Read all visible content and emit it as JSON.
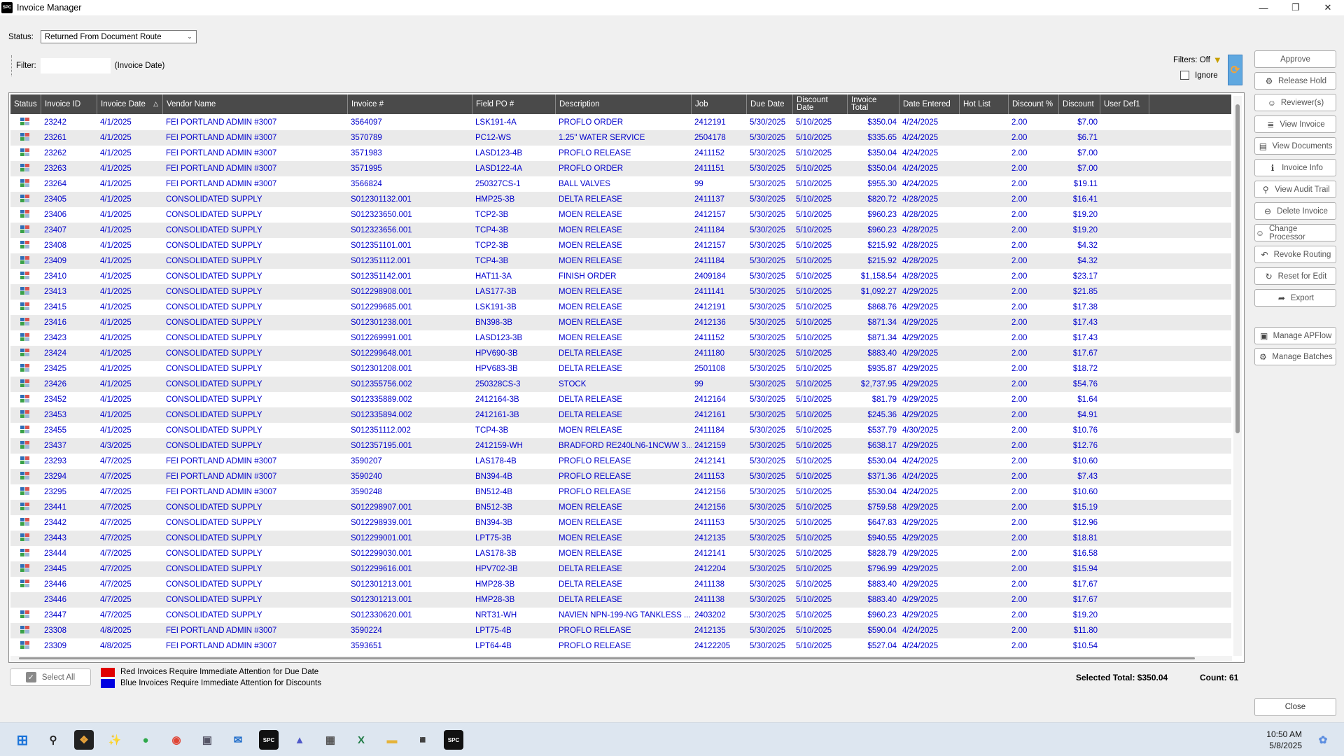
{
  "window": {
    "title": "Invoice Manager",
    "app_icon": "SPC",
    "controls": [
      "minimize-icon",
      "restore-icon",
      "close-icon"
    ]
  },
  "status_filter": {
    "label": "Status:",
    "value": "Returned From Document Route"
  },
  "filter": {
    "label": "Filter:",
    "value": "",
    "hint": "(Invoice Date)"
  },
  "filters_state": {
    "label": "Filters: Off",
    "ignore_label": "Ignore"
  },
  "columns": [
    "Status",
    "Invoice ID",
    "Invoice Date",
    "Vendor Name",
    "Invoice #",
    "Field PO #",
    "Description",
    "Job",
    "Due Date",
    "Discount Date",
    "Invoice Total",
    "Date Entered",
    "Hot List",
    "Discount %",
    "Discount",
    "User Def1"
  ],
  "rows": [
    {
      "id": "23242",
      "date": "4/1/2025",
      "vendor": "FEI PORTLAND ADMIN #3007",
      "inv": "3564097",
      "po": "LSK191-4A",
      "desc": "PROFLO ORDER",
      "job": "2412191",
      "due": "5/30/2025",
      "disc_date": "5/10/2025",
      "total": "$350.04",
      "entered": "4/24/2025",
      "pct": "2.00",
      "disc": "$7.00",
      "icon": true
    },
    {
      "id": "23261",
      "date": "4/1/2025",
      "vendor": "FEI PORTLAND ADMIN #3007",
      "inv": "3570789",
      "po": "PC12-WS",
      "desc": "1.25\" WATER SERVICE",
      "job": "2504178",
      "due": "5/30/2025",
      "disc_date": "5/10/2025",
      "total": "$335.65",
      "entered": "4/24/2025",
      "pct": "2.00",
      "disc": "$6.71",
      "icon": true
    },
    {
      "id": "23262",
      "date": "4/1/2025",
      "vendor": "FEI PORTLAND ADMIN #3007",
      "inv": "3571983",
      "po": "LASD123-4B",
      "desc": "PROFLO RELEASE",
      "job": "2411152",
      "due": "5/30/2025",
      "disc_date": "5/10/2025",
      "total": "$350.04",
      "entered": "4/24/2025",
      "pct": "2.00",
      "disc": "$7.00",
      "icon": true
    },
    {
      "id": "23263",
      "date": "4/1/2025",
      "vendor": "FEI PORTLAND ADMIN #3007",
      "inv": "3571995",
      "po": "LASD122-4A",
      "desc": "PROFLO ORDER",
      "job": "2411151",
      "due": "5/30/2025",
      "disc_date": "5/10/2025",
      "total": "$350.04",
      "entered": "4/24/2025",
      "pct": "2.00",
      "disc": "$7.00",
      "icon": true
    },
    {
      "id": "23264",
      "date": "4/1/2025",
      "vendor": "FEI PORTLAND ADMIN #3007",
      "inv": "3566824",
      "po": "250327CS-1",
      "desc": "BALL VALVES",
      "job": "99",
      "due": "5/30/2025",
      "disc_date": "5/10/2025",
      "total": "$955.30",
      "entered": "4/24/2025",
      "pct": "2.00",
      "disc": "$19.11",
      "icon": true
    },
    {
      "id": "23405",
      "date": "4/1/2025",
      "vendor": "CONSOLIDATED SUPPLY",
      "inv": "S012301132.001",
      "po": "HMP25-3B",
      "desc": "DELTA RELEASE",
      "job": "2411137",
      "due": "5/30/2025",
      "disc_date": "5/10/2025",
      "total": "$820.72",
      "entered": "4/28/2025",
      "pct": "2.00",
      "disc": "$16.41",
      "icon": true
    },
    {
      "id": "23406",
      "date": "4/1/2025",
      "vendor": "CONSOLIDATED SUPPLY",
      "inv": "S012323650.001",
      "po": "TCP2-3B",
      "desc": "MOEN RELEASE",
      "job": "2412157",
      "due": "5/30/2025",
      "disc_date": "5/10/2025",
      "total": "$960.23",
      "entered": "4/28/2025",
      "pct": "2.00",
      "disc": "$19.20",
      "icon": true
    },
    {
      "id": "23407",
      "date": "4/1/2025",
      "vendor": "CONSOLIDATED SUPPLY",
      "inv": "S012323656.001",
      "po": "TCP4-3B",
      "desc": "MOEN RELEASE",
      "job": "2411184",
      "due": "5/30/2025",
      "disc_date": "5/10/2025",
      "total": "$960.23",
      "entered": "4/28/2025",
      "pct": "2.00",
      "disc": "$19.20",
      "icon": true
    },
    {
      "id": "23408",
      "date": "4/1/2025",
      "vendor": "CONSOLIDATED SUPPLY",
      "inv": "S012351101.001",
      "po": "TCP2-3B",
      "desc": "MOEN RELEASE",
      "job": "2412157",
      "due": "5/30/2025",
      "disc_date": "5/10/2025",
      "total": "$215.92",
      "entered": "4/28/2025",
      "pct": "2.00",
      "disc": "$4.32",
      "icon": true
    },
    {
      "id": "23409",
      "date": "4/1/2025",
      "vendor": "CONSOLIDATED SUPPLY",
      "inv": "S012351112.001",
      "po": "TCP4-3B",
      "desc": "MOEN RELEASE",
      "job": "2411184",
      "due": "5/30/2025",
      "disc_date": "5/10/2025",
      "total": "$215.92",
      "entered": "4/28/2025",
      "pct": "2.00",
      "disc": "$4.32",
      "icon": true
    },
    {
      "id": "23410",
      "date": "4/1/2025",
      "vendor": "CONSOLIDATED SUPPLY",
      "inv": "S012351142.001",
      "po": "HAT11-3A",
      "desc": "FINISH ORDER",
      "job": "2409184",
      "due": "5/30/2025",
      "disc_date": "5/10/2025",
      "total": "$1,158.54",
      "entered": "4/28/2025",
      "pct": "2.00",
      "disc": "$23.17",
      "icon": true
    },
    {
      "id": "23413",
      "date": "4/1/2025",
      "vendor": "CONSOLIDATED SUPPLY",
      "inv": "S012298908.001",
      "po": "LAS177-3B",
      "desc": "MOEN RELEASE",
      "job": "2411141",
      "due": "5/30/2025",
      "disc_date": "5/10/2025",
      "total": "$1,092.27",
      "entered": "4/29/2025",
      "pct": "2.00",
      "disc": "$21.85",
      "icon": true
    },
    {
      "id": "23415",
      "date": "4/1/2025",
      "vendor": "CONSOLIDATED SUPPLY",
      "inv": "S012299685.001",
      "po": "LSK191-3B",
      "desc": "MOEN RELEASE",
      "job": "2412191",
      "due": "5/30/2025",
      "disc_date": "5/10/2025",
      "total": "$868.76",
      "entered": "4/29/2025",
      "pct": "2.00",
      "disc": "$17.38",
      "icon": true
    },
    {
      "id": "23416",
      "date": "4/1/2025",
      "vendor": "CONSOLIDATED SUPPLY",
      "inv": "S012301238.001",
      "po": "BN398-3B",
      "desc": "MOEN RELEASE",
      "job": "2412136",
      "due": "5/30/2025",
      "disc_date": "5/10/2025",
      "total": "$871.34",
      "entered": "4/29/2025",
      "pct": "2.00",
      "disc": "$17.43",
      "icon": true
    },
    {
      "id": "23423",
      "date": "4/1/2025",
      "vendor": "CONSOLIDATED SUPPLY",
      "inv": "S012269991.001",
      "po": "LASD123-3B",
      "desc": "MOEN RELEASE",
      "job": "2411152",
      "due": "5/30/2025",
      "disc_date": "5/10/2025",
      "total": "$871.34",
      "entered": "4/29/2025",
      "pct": "2.00",
      "disc": "$17.43",
      "icon": true
    },
    {
      "id": "23424",
      "date": "4/1/2025",
      "vendor": "CONSOLIDATED SUPPLY",
      "inv": "S012299648.001",
      "po": "HPV690-3B",
      "desc": "DELTA RELEASE",
      "job": "2411180",
      "due": "5/30/2025",
      "disc_date": "5/10/2025",
      "total": "$883.40",
      "entered": "4/29/2025",
      "pct": "2.00",
      "disc": "$17.67",
      "icon": true
    },
    {
      "id": "23425",
      "date": "4/1/2025",
      "vendor": "CONSOLIDATED SUPPLY",
      "inv": "S012301208.001",
      "po": "HPV683-3B",
      "desc": "DELTA RELEASE",
      "job": "2501108",
      "due": "5/30/2025",
      "disc_date": "5/10/2025",
      "total": "$935.87",
      "entered": "4/29/2025",
      "pct": "2.00",
      "disc": "$18.72",
      "icon": true
    },
    {
      "id": "23426",
      "date": "4/1/2025",
      "vendor": "CONSOLIDATED SUPPLY",
      "inv": "S012355756.002",
      "po": "250328CS-3",
      "desc": "STOCK",
      "job": "99",
      "due": "5/30/2025",
      "disc_date": "5/10/2025",
      "total": "$2,737.95",
      "entered": "4/29/2025",
      "pct": "2.00",
      "disc": "$54.76",
      "icon": true
    },
    {
      "id": "23452",
      "date": "4/1/2025",
      "vendor": "CONSOLIDATED SUPPLY",
      "inv": "S012335889.002",
      "po": "2412164-3B",
      "desc": "DELTA RELEASE",
      "job": "2412164",
      "due": "5/30/2025",
      "disc_date": "5/10/2025",
      "total": "$81.79",
      "entered": "4/29/2025",
      "pct": "2.00",
      "disc": "$1.64",
      "icon": true
    },
    {
      "id": "23453",
      "date": "4/1/2025",
      "vendor": "CONSOLIDATED SUPPLY",
      "inv": "S012335894.002",
      "po": "2412161-3B",
      "desc": "DELTA RELEASE",
      "job": "2412161",
      "due": "5/30/2025",
      "disc_date": "5/10/2025",
      "total": "$245.36",
      "entered": "4/29/2025",
      "pct": "2.00",
      "disc": "$4.91",
      "icon": true
    },
    {
      "id": "23455",
      "date": "4/1/2025",
      "vendor": "CONSOLIDATED SUPPLY",
      "inv": "S012351112.002",
      "po": "TCP4-3B",
      "desc": "MOEN RELEASE",
      "job": "2411184",
      "due": "5/30/2025",
      "disc_date": "5/10/2025",
      "total": "$537.79",
      "entered": "4/30/2025",
      "pct": "2.00",
      "disc": "$10.76",
      "icon": true
    },
    {
      "id": "23437",
      "date": "4/3/2025",
      "vendor": "CONSOLIDATED SUPPLY",
      "inv": "S012357195.001",
      "po": "2412159-WH",
      "desc": "BRADFORD RE240LN6-1NCWW 3...",
      "job": "2412159",
      "due": "5/30/2025",
      "disc_date": "5/10/2025",
      "total": "$638.17",
      "entered": "4/29/2025",
      "pct": "2.00",
      "disc": "$12.76",
      "icon": true
    },
    {
      "id": "23293",
      "date": "4/7/2025",
      "vendor": "FEI PORTLAND ADMIN #3007",
      "inv": "3590207",
      "po": "LAS178-4B",
      "desc": "PROFLO RELEASE",
      "job": "2412141",
      "due": "5/30/2025",
      "disc_date": "5/10/2025",
      "total": "$530.04",
      "entered": "4/24/2025",
      "pct": "2.00",
      "disc": "$10.60",
      "icon": true
    },
    {
      "id": "23294",
      "date": "4/7/2025",
      "vendor": "FEI PORTLAND ADMIN #3007",
      "inv": "3590240",
      "po": "BN394-4B",
      "desc": "PROFLO RELEASE",
      "job": "2411153",
      "due": "5/30/2025",
      "disc_date": "5/10/2025",
      "total": "$371.36",
      "entered": "4/24/2025",
      "pct": "2.00",
      "disc": "$7.43",
      "icon": true
    },
    {
      "id": "23295",
      "date": "4/7/2025",
      "vendor": "FEI PORTLAND ADMIN #3007",
      "inv": "3590248",
      "po": "BN512-4B",
      "desc": "PROFLO RELEASE",
      "job": "2412156",
      "due": "5/30/2025",
      "disc_date": "5/10/2025",
      "total": "$530.04",
      "entered": "4/24/2025",
      "pct": "2.00",
      "disc": "$10.60",
      "icon": true
    },
    {
      "id": "23441",
      "date": "4/7/2025",
      "vendor": "CONSOLIDATED SUPPLY",
      "inv": "S012298907.001",
      "po": "BN512-3B",
      "desc": "MOEN RELEASE",
      "job": "2412156",
      "due": "5/30/2025",
      "disc_date": "5/10/2025",
      "total": "$759.58",
      "entered": "4/29/2025",
      "pct": "2.00",
      "disc": "$15.19",
      "icon": true
    },
    {
      "id": "23442",
      "date": "4/7/2025",
      "vendor": "CONSOLIDATED SUPPLY",
      "inv": "S012298939.001",
      "po": "BN394-3B",
      "desc": "MOEN RELEASE",
      "job": "2411153",
      "due": "5/30/2025",
      "disc_date": "5/10/2025",
      "total": "$647.83",
      "entered": "4/29/2025",
      "pct": "2.00",
      "disc": "$12.96",
      "icon": true
    },
    {
      "id": "23443",
      "date": "4/7/2025",
      "vendor": "CONSOLIDATED SUPPLY",
      "inv": "S012299001.001",
      "po": "LPT75-3B",
      "desc": "MOEN RELEASE",
      "job": "2412135",
      "due": "5/30/2025",
      "disc_date": "5/10/2025",
      "total": "$940.55",
      "entered": "4/29/2025",
      "pct": "2.00",
      "disc": "$18.81",
      "icon": true
    },
    {
      "id": "23444",
      "date": "4/7/2025",
      "vendor": "CONSOLIDATED SUPPLY",
      "inv": "S012299030.001",
      "po": "LAS178-3B",
      "desc": "MOEN RELEASE",
      "job": "2412141",
      "due": "5/30/2025",
      "disc_date": "5/10/2025",
      "total": "$828.79",
      "entered": "4/29/2025",
      "pct": "2.00",
      "disc": "$16.58",
      "icon": true
    },
    {
      "id": "23445",
      "date": "4/7/2025",
      "vendor": "CONSOLIDATED SUPPLY",
      "inv": "S012299616.001",
      "po": "HPV702-3B",
      "desc": "DELTA RELEASE",
      "job": "2412204",
      "due": "5/30/2025",
      "disc_date": "5/10/2025",
      "total": "$796.99",
      "entered": "4/29/2025",
      "pct": "2.00",
      "disc": "$15.94",
      "icon": true
    },
    {
      "id": "23446",
      "date": "4/7/2025",
      "vendor": "CONSOLIDATED SUPPLY",
      "inv": "S012301213.001",
      "po": "HMP28-3B",
      "desc": "DELTA RELEASE",
      "job": "2411138",
      "due": "5/30/2025",
      "disc_date": "5/10/2025",
      "total": "$883.40",
      "entered": "4/29/2025",
      "pct": "2.00",
      "disc": "$17.67",
      "icon": true
    },
    {
      "id": "23446",
      "date": "4/7/2025",
      "vendor": "CONSOLIDATED SUPPLY",
      "inv": "S012301213.001",
      "po": "HMP28-3B",
      "desc": "DELTA RELEASE",
      "job": "2411138",
      "due": "5/30/2025",
      "disc_date": "5/10/2025",
      "total": "$883.40",
      "entered": "4/29/2025",
      "pct": "2.00",
      "disc": "$17.67",
      "icon": false
    },
    {
      "id": "23447",
      "date": "4/7/2025",
      "vendor": "CONSOLIDATED SUPPLY",
      "inv": "S012330620.001",
      "po": "NRT31-WH",
      "desc": "NAVIEN NPN-199-NG TANKLESS ...",
      "job": "2403202",
      "due": "5/30/2025",
      "disc_date": "5/10/2025",
      "total": "$960.23",
      "entered": "4/29/2025",
      "pct": "2.00",
      "disc": "$19.20",
      "icon": true
    },
    {
      "id": "23308",
      "date": "4/8/2025",
      "vendor": "FEI PORTLAND ADMIN #3007",
      "inv": "3590224",
      "po": "LPT75-4B",
      "desc": "PROFLO RELEASE",
      "job": "2412135",
      "due": "5/30/2025",
      "disc_date": "5/10/2025",
      "total": "$590.04",
      "entered": "4/24/2025",
      "pct": "2.00",
      "disc": "$11.80",
      "icon": true
    },
    {
      "id": "23309",
      "date": "4/8/2025",
      "vendor": "FEI PORTLAND ADMIN #3007",
      "inv": "3593651",
      "po": "LPT64-4B",
      "desc": "PROFLO RELEASE",
      "job": "24122205",
      "due": "5/30/2025",
      "disc_date": "5/10/2025",
      "total": "$527.04",
      "entered": "4/24/2025",
      "pct": "2.00",
      "disc": "$10.54",
      "icon": true
    }
  ],
  "actions": [
    {
      "label": "Approve",
      "icon": ""
    },
    {
      "label": "Release Hold",
      "icon": "release-hold-icon"
    },
    {
      "label": "Reviewer(s)",
      "icon": "reviewers-icon"
    },
    {
      "label": "View Invoice",
      "icon": "view-invoice-icon"
    },
    {
      "label": "View Documents",
      "icon": "documents-icon"
    },
    {
      "label": "Invoice Info",
      "icon": "info-icon"
    },
    {
      "label": "View Audit Trail",
      "icon": "search-icon"
    },
    {
      "label": "Delete Invoice",
      "icon": "delete-icon"
    },
    {
      "label": "Change Processor",
      "icon": "user-icon"
    },
    {
      "label": "Revoke Routing",
      "icon": "undo-icon"
    },
    {
      "label": "Reset for Edit",
      "icon": "reset-icon"
    },
    {
      "label": "Export",
      "icon": "export-arrow-icon"
    },
    {
      "label": "Manage APFlow",
      "icon": "apflow-icon"
    },
    {
      "label": "Manage Batches",
      "icon": "gear-icon"
    }
  ],
  "footer": {
    "select_all": "Select All",
    "legend_red": "Red Invoices Require Immediate Attention for Due Date",
    "legend_blue": "Blue Invoices Require Immediate Attention for Discounts",
    "selected_total": "Selected Total:  $350.04",
    "count": "Count:  61",
    "close": "Close"
  },
  "colors": {
    "legend_red": "#e00000",
    "legend_blue": "#0000e0",
    "row_text": "#0000cc",
    "header_bg": "#4a4a4a"
  },
  "taskbar": {
    "time": "10:50 AM",
    "date": "5/8/2025"
  }
}
